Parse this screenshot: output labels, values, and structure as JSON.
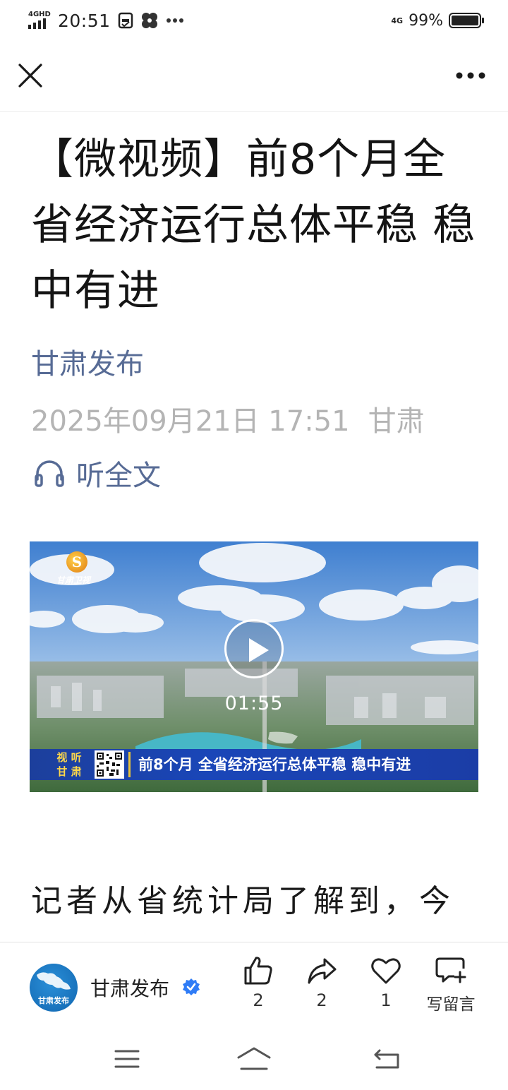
{
  "status_bar": {
    "network": "4GHD",
    "time": "20:51",
    "signal_4g": "4G",
    "battery_pct": "99%",
    "battery_level": 0.99
  },
  "nav": {
    "close_icon": "close-icon",
    "more_icon": "more-icon"
  },
  "article": {
    "title": "【微视频】前8个月全省经济运行总体平稳 稳中有进",
    "author": "甘肃发布",
    "date": "2025年09月21日 17:51",
    "location": "甘肃",
    "listen_label": "听全文",
    "body_first_line": "记者从省统计局了解到，今"
  },
  "video": {
    "channel_logo_letter": "S",
    "channel_name": "甘肃卫视",
    "duration": "01:55",
    "banner_side": [
      "视 听",
      "甘 肃"
    ],
    "banner_text": "前8个月 全省经济运行总体平稳 稳中有进"
  },
  "action_bar": {
    "account_name": "甘肃发布",
    "avatar_text": "甘肃发布",
    "like_count": "2",
    "share_count": "2",
    "favorite_count": "1",
    "comment_label": "写留言"
  },
  "colors": {
    "link": "#576b95",
    "meta": "#b4b4b4",
    "banner": "#1a46b8",
    "verified": "#2f7cf6"
  }
}
